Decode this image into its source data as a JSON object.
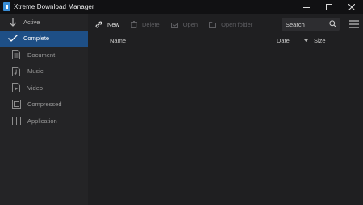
{
  "window": {
    "title": "Xtreme Download Manager",
    "controls": [
      "minimize",
      "maximize",
      "close"
    ]
  },
  "sidebar": {
    "items": [
      {
        "label": "Active",
        "icon": "arrow-down-icon"
      },
      {
        "label": "Complete",
        "icon": "checkmark-icon",
        "selected": true
      },
      {
        "label": "Document",
        "icon": "document-icon"
      },
      {
        "label": "Music",
        "icon": "music-icon"
      },
      {
        "label": "Video",
        "icon": "video-icon"
      },
      {
        "label": "Compressed",
        "icon": "compressed-icon"
      },
      {
        "label": "Application",
        "icon": "application-icon"
      }
    ]
  },
  "toolbar": {
    "new_label": "New",
    "delete_label": "Delete",
    "open_label": "Open",
    "open_folder_label": "Open folder",
    "search_placeholder": "Search"
  },
  "list": {
    "columns": {
      "name": "Name",
      "date": "Date",
      "size": "Size"
    },
    "rows": []
  },
  "colors": {
    "titlebar": "#111113",
    "sidebar": "#242426",
    "selected": "#1e4f86",
    "main": "#1f1f21"
  }
}
